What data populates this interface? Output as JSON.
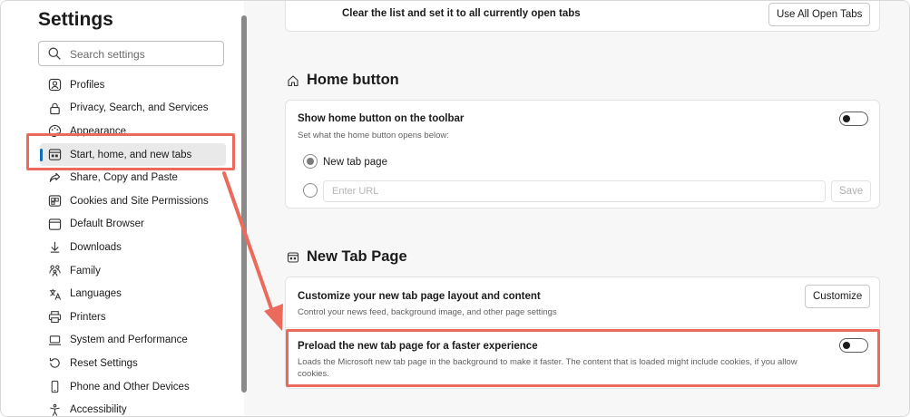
{
  "sidebar": {
    "title": "Settings",
    "search_placeholder": "Search settings",
    "items": [
      {
        "label": "Profiles",
        "icon": "profile-icon"
      },
      {
        "label": "Privacy, Search, and Services",
        "icon": "lock-icon"
      },
      {
        "label": "Appearance",
        "icon": "palette-icon"
      },
      {
        "label": "Start, home, and new tabs",
        "icon": "home-tabs-icon",
        "active": true
      },
      {
        "label": "Share, Copy and Paste",
        "icon": "share-icon"
      },
      {
        "label": "Cookies and Site Permissions",
        "icon": "cookies-icon"
      },
      {
        "label": "Default Browser",
        "icon": "browser-icon"
      },
      {
        "label": "Downloads",
        "icon": "download-icon"
      },
      {
        "label": "Family",
        "icon": "family-icon"
      },
      {
        "label": "Languages",
        "icon": "languages-icon"
      },
      {
        "label": "Printers",
        "icon": "printer-icon"
      },
      {
        "label": "System and Performance",
        "icon": "laptop-icon"
      },
      {
        "label": "Reset Settings",
        "icon": "reset-icon"
      },
      {
        "label": "Phone and Other Devices",
        "icon": "phone-icon"
      },
      {
        "label": "Accessibility",
        "icon": "accessibility-icon"
      }
    ]
  },
  "main": {
    "startup_row": {
      "title": "Clear the list and set it to all currently open tabs",
      "button": "Use All Open Tabs"
    },
    "home_section": {
      "heading": "Home button",
      "icon": "home-icon",
      "toggle_title": "Show home button on the toolbar",
      "toggle_desc": "Set what the home button opens below:",
      "toggle_on": false,
      "radio_new_tab": "New tab page",
      "url_placeholder": "Enter URL",
      "save_button": "Save"
    },
    "newtab_section": {
      "heading": "New Tab Page",
      "icon": "newtab-icon",
      "customize_title": "Customize your new tab page layout and content",
      "customize_desc": "Control your news feed, background image, and other page settings",
      "customize_button": "Customize",
      "preload_title": "Preload the new tab page for a faster experience",
      "preload_desc": "Loads the Microsoft new tab page in the background to make it faster. The content that is loaded might include cookies, if you allow cookies.",
      "preload_on": false
    }
  },
  "colors": {
    "highlight": "#ec6a5c",
    "accent": "#0f6cbd"
  }
}
